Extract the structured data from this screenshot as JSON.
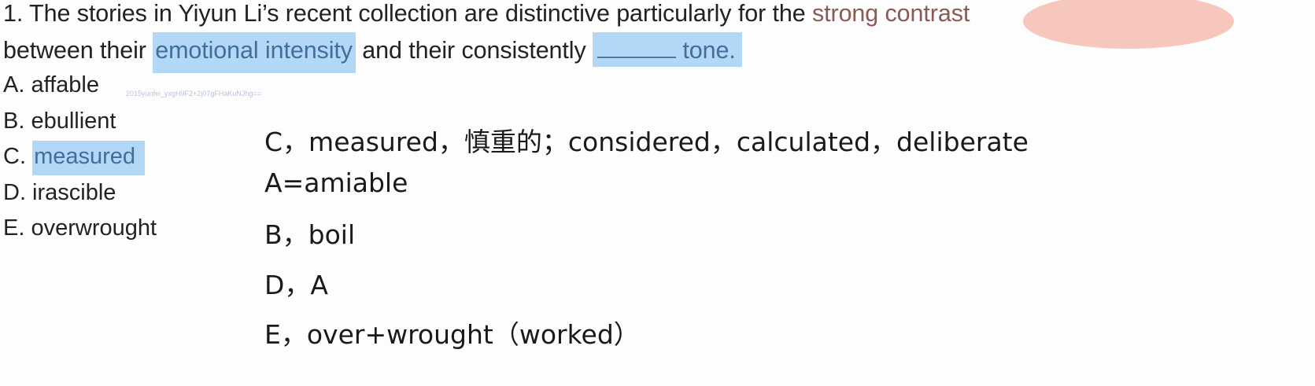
{
  "question": {
    "line1_prefix": "1. The stories in Yiyun Li’s recent collection are distinctive particularly for the ",
    "line1_highlight": "strong contrast",
    "line2_start": "between their ",
    "line2_highlight1": "emotional intensity",
    "line2_middle": " and their consistently ",
    "line2_highlight2": "tone."
  },
  "options": [
    {
      "label": "A. affable"
    },
    {
      "label": "B. ebullient"
    },
    {
      "label": "C. ",
      "highlight": "measured"
    },
    {
      "label": "D. irascible"
    },
    {
      "label": "E. overwrought"
    }
  ],
  "watermark": "2015yunfei_yxgH9F2+2j07gFHaKuNJhg==",
  "notes": [
    "C，measured，慎重的；considered，calculated，deliberate",
    "A=amiable",
    "B，boil",
    "D，A",
    "E，over+wrought（worked）"
  ],
  "colors": {
    "blue_highlight": "#b3d8f7",
    "pink_highlight": "#f7c6bd"
  }
}
